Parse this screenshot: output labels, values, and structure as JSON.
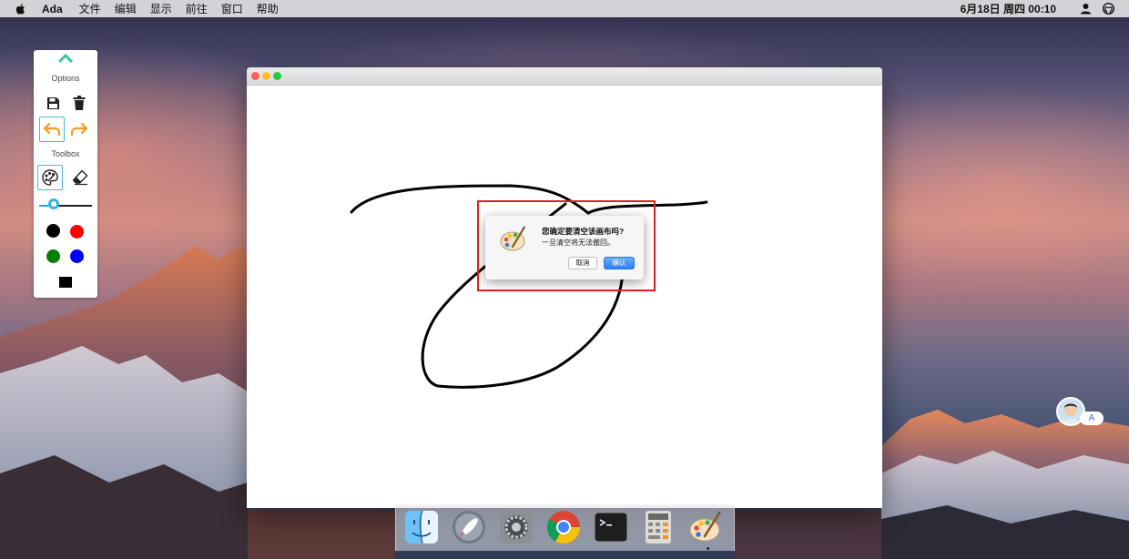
{
  "menubar": {
    "app_name": "Ada",
    "menus": [
      "文件",
      "编辑",
      "显示",
      "前往",
      "窗口",
      "帮助"
    ],
    "clock": "6月18日 周四 00:10",
    "icons": [
      "apple-logo-icon",
      "user-icon",
      "github-icon"
    ]
  },
  "toolpanel": {
    "options_label": "Options",
    "toolbox_label": "Toolbox",
    "buttons": [
      "save-icon",
      "trash-icon",
      "undo-icon",
      "redo-icon",
      "palette-icon",
      "eraser-icon"
    ],
    "brush_size_fraction": 0.27,
    "colors": [
      {
        "name": "black",
        "hex": "#000000"
      },
      {
        "name": "red",
        "hex": "#ff0000"
      },
      {
        "name": "green",
        "hex": "#008000"
      },
      {
        "name": "blue",
        "hex": "#0000ff"
      }
    ],
    "current_color": "#000000",
    "accent": "#4ab8d6"
  },
  "window": {
    "traffic_lights": [
      "#fe5f57",
      "#febc2e",
      "#28c840"
    ]
  },
  "dialog": {
    "title": "您确定要清空该画布吗?",
    "message": "一旦清空将无法撤回。",
    "cancel_label": "取消",
    "confirm_label": "确认",
    "highlight_color": "#e0201c"
  },
  "dock": {
    "apps": [
      "finder-icon",
      "launchpad-icon",
      "system-preferences-icon",
      "chrome-icon",
      "terminal-icon",
      "calculator-icon",
      "paint-app-icon"
    ]
  },
  "avatar_widget": {
    "badge": "A"
  }
}
